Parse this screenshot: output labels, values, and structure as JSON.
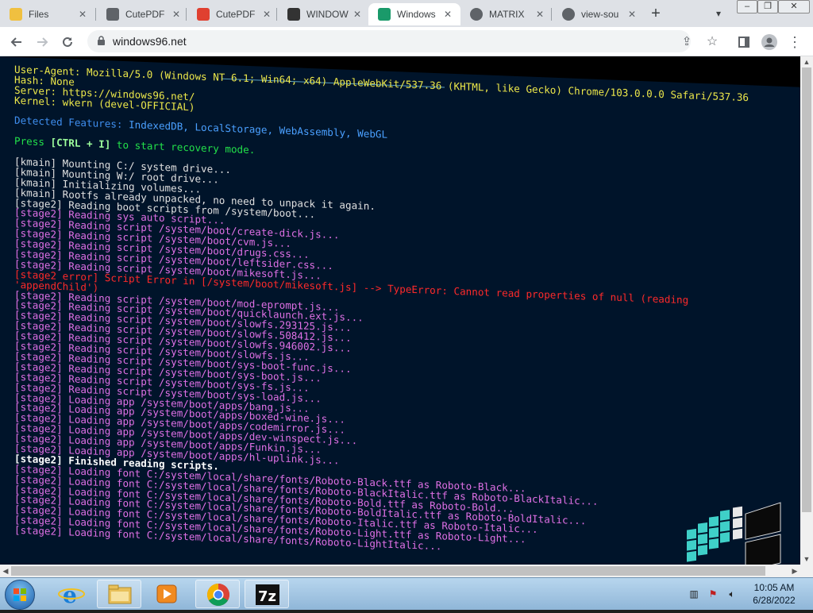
{
  "browser": {
    "tabs": [
      {
        "label": "Files",
        "icon": "folder-icon",
        "active": false
      },
      {
        "label": "CutePDF",
        "icon": "cutepdf-icon",
        "active": false
      },
      {
        "label": "CutePDF",
        "icon": "pdf-icon",
        "active": false
      },
      {
        "label": "WINDOW",
        "icon": "shield-icon",
        "active": false
      },
      {
        "label": "Windows",
        "icon": "windows96-icon",
        "active": true
      },
      {
        "label": "MATRIX",
        "icon": "globe-icon",
        "active": false
      },
      {
        "label": "view-sou",
        "icon": "globe-icon",
        "active": false
      }
    ],
    "url": "windows96.net"
  },
  "terminal": {
    "lines": [
      {
        "text": "User-Agent: Mozilla/5.0 (Windows NT 6.1; Win64; x64) AppleWebKit/537.36 (KHTML, like Gecko) Chrome/103.0.0.0 Safari/537.36",
        "color": "yellow"
      },
      {
        "text": "Hash: None",
        "color": "yellow"
      },
      {
        "text": "Server: https://windows96.net/",
        "color": "yellow"
      },
      {
        "text": "Kernel: wkern (devel-OFFICIAL)",
        "color": "yellow"
      },
      {
        "text": "",
        "color": "white"
      },
      {
        "text": "Detected Features: IndexedDB, LocalStorage, WebAssembly, WebGL",
        "color": "blue"
      },
      {
        "text": "",
        "color": "white"
      },
      {
        "text": "Press [CTRL + I] to start recovery mode.",
        "color": "green"
      },
      {
        "text": "",
        "color": "white"
      },
      {
        "text": "[kmain] Mounting C:/ system drive...",
        "color": "white"
      },
      {
        "text": "[kmain] Mounting W:/ root drive...",
        "color": "white"
      },
      {
        "text": "[kmain] Initializing volumes...",
        "color": "white"
      },
      {
        "text": "[kmain] Rootfs already unpacked, no need to unpack it again.",
        "color": "white"
      },
      {
        "text": "[stage2] Reading boot scripts from /system/boot...",
        "color": "white"
      },
      {
        "text": "[stage2] Reading sys auto script...",
        "color": "magenta"
      },
      {
        "text": "[stage2] Reading script /system/boot/create-dick.js...",
        "color": "magenta"
      },
      {
        "text": "[stage2] Reading script /system/boot/cvm.js...",
        "color": "magenta"
      },
      {
        "text": "[stage2] Reading script /system/boot/drugs.css...",
        "color": "magenta"
      },
      {
        "text": "[stage2] Reading script /system/boot/leftsider.css...",
        "color": "magenta"
      },
      {
        "text": "[stage2] Reading script /system/boot/mikesoft.js...",
        "color": "magenta"
      },
      {
        "text": "[stage2 error] Script Error in [/system/boot/mikesoft.js] --> TypeError: Cannot read properties of null (reading",
        "color": "red"
      },
      {
        "text": "'appendChild')",
        "color": "red"
      },
      {
        "text": "[stage2] Reading script /system/boot/mod-eprompt.js...",
        "color": "magenta"
      },
      {
        "text": "[stage2] Reading script /system/boot/quicklaunch.ext.js...",
        "color": "magenta"
      },
      {
        "text": "[stage2] Reading script /system/boot/slowfs.293125.js...",
        "color": "magenta"
      },
      {
        "text": "[stage2] Reading script /system/boot/slowfs.508412.js...",
        "color": "magenta"
      },
      {
        "text": "[stage2] Reading script /system/boot/slowfs.946002.js...",
        "color": "magenta"
      },
      {
        "text": "[stage2] Reading script /system/boot/slowfs.js...",
        "color": "magenta"
      },
      {
        "text": "[stage2] Reading script /system/boot/sys-boot-func.js...",
        "color": "magenta"
      },
      {
        "text": "[stage2] Reading script /system/boot/sys-boot.js...",
        "color": "magenta"
      },
      {
        "text": "[stage2] Reading script /system/boot/sys-fs.js...",
        "color": "magenta"
      },
      {
        "text": "[stage2] Reading script /system/boot/sys-load.js...",
        "color": "magenta"
      },
      {
        "text": "[stage2] Loading app /system/boot/apps/bang.js...",
        "color": "magenta"
      },
      {
        "text": "[stage2] Loading app /system/boot/apps/boxed-wine.js...",
        "color": "magenta"
      },
      {
        "text": "[stage2] Loading app /system/boot/apps/codemirror.js...",
        "color": "magenta"
      },
      {
        "text": "[stage2] Loading app /system/boot/apps/dev-winspect.js...",
        "color": "magenta"
      },
      {
        "text": "[stage2] Loading app /system/boot/apps/Funkin.js...",
        "color": "magenta"
      },
      {
        "text": "[stage2] Loading app /system/boot/apps/hl-uplink.js...",
        "color": "magenta"
      },
      {
        "text": "[stage2] Finished reading scripts.",
        "color": "bright"
      },
      {
        "text": "[stage2] Loading font C:/system/local/share/fonts/Roboto-Black.ttf as Roboto-Black...",
        "color": "magenta"
      },
      {
        "text": "[stage2] Loading font C:/system/local/share/fonts/Roboto-BlackItalic.ttf as Roboto-BlackItalic...",
        "color": "magenta"
      },
      {
        "text": "[stage2] Loading font C:/system/local/share/fonts/Roboto-Bold.ttf as Roboto-Bold...",
        "color": "magenta"
      },
      {
        "text": "[stage2] Loading font C:/system/local/share/fonts/Roboto-BoldItalic.ttf as Roboto-BoldItalic...",
        "color": "magenta"
      },
      {
        "text": "[stage2] Loading font C:/system/local/share/fonts/Roboto-Italic.ttf as Roboto-Italic...",
        "color": "magenta"
      },
      {
        "text": "[stage2] Loading font C:/system/local/share/fonts/Roboto-Light.ttf as Roboto-Light...",
        "color": "magenta"
      },
      {
        "text": "[stage2] Loading font C:/system/local/share/fonts/Roboto-LightItalic...",
        "color": "magenta"
      }
    ]
  },
  "taskbar": {
    "apps": [
      {
        "icon": "internet-explorer-icon"
      },
      {
        "icon": "file-explorer-icon"
      },
      {
        "icon": "media-player-icon"
      },
      {
        "icon": "chrome-icon"
      },
      {
        "icon": "7zip-icon"
      }
    ],
    "time": "10:05 AM",
    "date": "6/28/2022"
  },
  "colors": {
    "terminal_bg": "#00142a",
    "yellow": "#ece74a",
    "blue": "#3f8ff0",
    "green": "#22e14a",
    "magenta": "#e070e6",
    "red": "#ff2a2a"
  }
}
